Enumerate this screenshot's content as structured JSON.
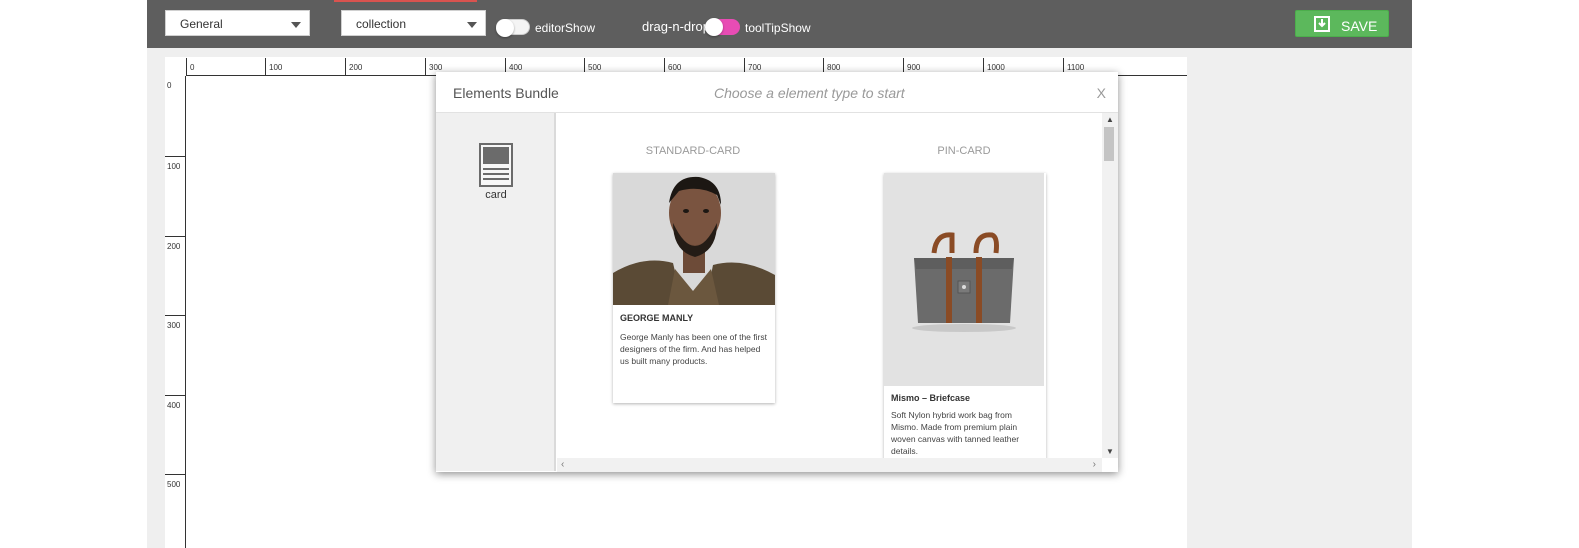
{
  "toolbar": {
    "select_general": "General",
    "select_collection": "collection",
    "toggle_editor_label": "editorShow",
    "dragdrop_label": "drag-n-drop",
    "toggle_tooltip_label": "toolTipShow",
    "save_label": "SAVE",
    "colors": {
      "bar": "#5e5e5e",
      "save": "#5cb85c",
      "toggle_on": "#e84cb4",
      "toggle_off": "#ffffff"
    }
  },
  "ruler": {
    "horizontal": [
      "0",
      "100",
      "200",
      "300",
      "400",
      "500",
      "600",
      "700",
      "800",
      "900",
      "1000",
      "1100"
    ],
    "vertical": [
      "0",
      "100",
      "200",
      "300",
      "400",
      "500"
    ]
  },
  "modal": {
    "title": "Elements Bundle",
    "hint": "Choose a element type to start",
    "close": "X",
    "types": [
      {
        "label": "card",
        "icon": "card-icon"
      }
    ],
    "cards": [
      {
        "type": "STANDARD-CARD",
        "name": "GEORGE MANLY",
        "desc": [
          "George Manly has been one of the first",
          "designers of the firm. And has helped",
          "us built many products."
        ]
      },
      {
        "type": "PIN-CARD",
        "name": "Mismo – Briefcase",
        "desc": [
          "Soft Nylon hybrid work bag from",
          "Mismo. Made from premium plain",
          "woven canvas with tanned leather",
          "details."
        ]
      }
    ]
  }
}
